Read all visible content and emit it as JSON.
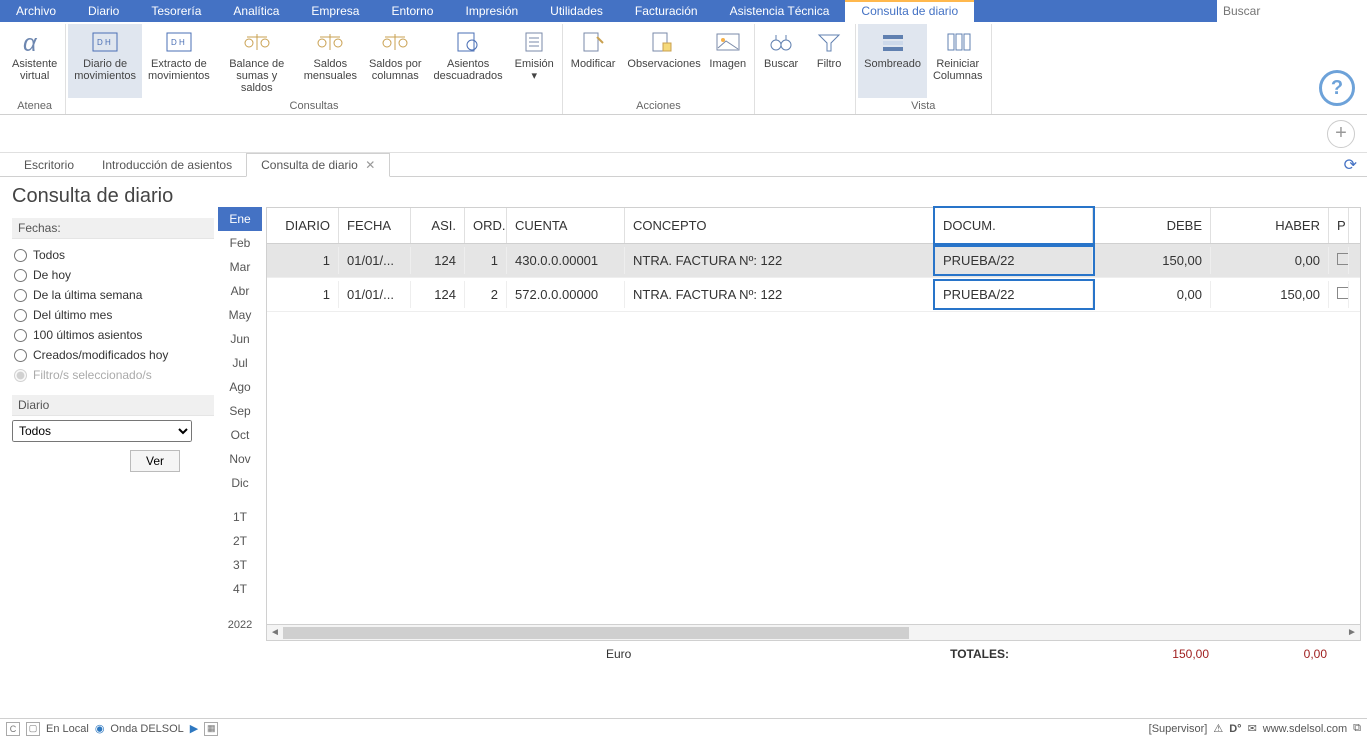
{
  "menu": {
    "items": [
      "Archivo",
      "Diario",
      "Tesorería",
      "Analítica",
      "Empresa",
      "Entorno",
      "Impresión",
      "Utilidades",
      "Facturación",
      "Asistencia Técnica",
      "Consulta de diario"
    ],
    "activeIndex": 10,
    "searchPlaceholder": "Buscar"
  },
  "ribbon": {
    "groups": [
      {
        "title": "Atenea",
        "buttons": [
          {
            "label": "Asistente\nvirtual",
            "icon": "alpha"
          }
        ]
      },
      {
        "title": "Consultas",
        "buttons": [
          {
            "label": "Diario de\nmovimientos",
            "icon": "doc-dh",
            "active": true
          },
          {
            "label": "Extracto de\nmovimientos",
            "icon": "doc-dh2"
          },
          {
            "label": "Balance de\nsumas y saldos",
            "icon": "scales"
          },
          {
            "label": "Saldos\nmensuales",
            "icon": "scales"
          },
          {
            "label": "Saldos por\ncolumnas",
            "icon": "scales"
          },
          {
            "label": "Asientos\ndescuadrados",
            "icon": "doc-search"
          },
          {
            "label": "Emisión\n▾",
            "icon": "doc-lines"
          }
        ]
      },
      {
        "title": "Acciones",
        "buttons": [
          {
            "label": "Modificar",
            "icon": "doc-pencil"
          },
          {
            "label": "Observaciones",
            "icon": "doc-note"
          },
          {
            "label": "Imagen",
            "icon": "picture"
          }
        ]
      },
      {
        "title": "",
        "buttons": [
          {
            "label": "Buscar",
            "icon": "binocular"
          },
          {
            "label": "Filtro",
            "icon": "funnel"
          }
        ]
      },
      {
        "title": "Vista",
        "buttons": [
          {
            "label": "Sombreado",
            "icon": "shade",
            "active": true
          },
          {
            "label": "Reiniciar\nColumnas",
            "icon": "cols"
          }
        ]
      }
    ]
  },
  "wsTabs": {
    "tabs": [
      {
        "label": "Escritorio"
      },
      {
        "label": "Introducción de asientos"
      },
      {
        "label": "Consulta de diario",
        "active": true,
        "closable": true
      }
    ]
  },
  "page": {
    "title": "Consulta de diario",
    "fechasLabel": "Fechas:",
    "radios": [
      "Todos",
      "De hoy",
      "De la última semana",
      "Del último mes",
      "100 últimos asientos",
      "Creados/modificados hoy"
    ],
    "radioDisabled": "Filtro/s seleccionado/s",
    "diarioLabel": "Diario",
    "diarioValue": "Todos",
    "verLabel": "Ver"
  },
  "months": {
    "list": [
      "Ene",
      "Feb",
      "Mar",
      "Abr",
      "May",
      "Jun",
      "Jul",
      "Ago",
      "Sep",
      "Oct",
      "Nov",
      "Dic"
    ],
    "activeIndex": 0,
    "quarters": [
      "1T",
      "2T",
      "3T",
      "4T"
    ],
    "year": "2022"
  },
  "table": {
    "headers": [
      "DIARIO",
      "FECHA",
      "ASI.",
      "ORD.",
      "CUENTA",
      "CONCEPTO",
      "DOCUM.",
      "DEBE",
      "HABER",
      "P"
    ],
    "rows": [
      {
        "diario": "1",
        "fecha": "01/01/...",
        "asi": "124",
        "ord": "1",
        "cuenta": "430.0.0.00001",
        "concepto": "NTRA. FACTURA Nº:  122",
        "docum": "PRUEBA/22",
        "debe": "150,00",
        "haber": "0,00",
        "selected": true
      },
      {
        "diario": "1",
        "fecha": "01/01/...",
        "asi": "124",
        "ord": "2",
        "cuenta": "572.0.0.00000",
        "concepto": "NTRA. FACTURA Nº:  122",
        "docum": "PRUEBA/22",
        "debe": "0,00",
        "haber": "150,00"
      }
    ],
    "currency": "Euro",
    "totalsLabel": "TOTALES:",
    "totalDebe": "150,00",
    "totalHaber": "0,00"
  },
  "status": {
    "local": "En Local",
    "onda": "Onda DELSOL",
    "supervisor": "[Supervisor]",
    "url": "www.sdelsol.com"
  }
}
